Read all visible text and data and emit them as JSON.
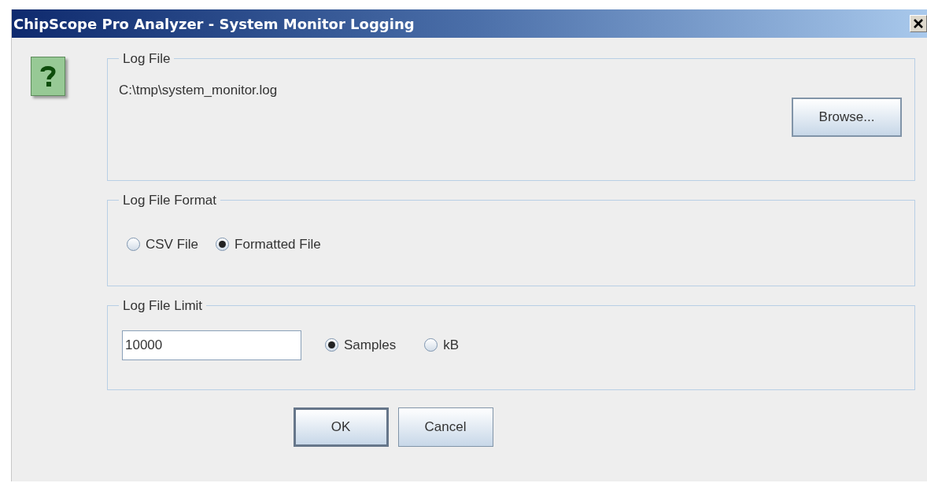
{
  "window": {
    "title": "ChipScope Pro Analyzer - System Monitor Logging"
  },
  "log_file": {
    "legend": "Log File",
    "path": "C:\\tmp\\system_monitor.log",
    "browse_button": "Browse..."
  },
  "log_file_format": {
    "legend": "Log File Format",
    "options": [
      {
        "label": "CSV File",
        "selected": false
      },
      {
        "label": "Formatted File",
        "selected": true
      }
    ]
  },
  "log_file_limit": {
    "legend": "Log File Limit",
    "value": "10000",
    "units": [
      {
        "label": "Samples",
        "selected": true
      },
      {
        "label": "kB",
        "selected": false
      }
    ]
  },
  "buttons": [
    {
      "label": "OK",
      "default": true
    },
    {
      "label": "Cancel",
      "default": false
    }
  ]
}
